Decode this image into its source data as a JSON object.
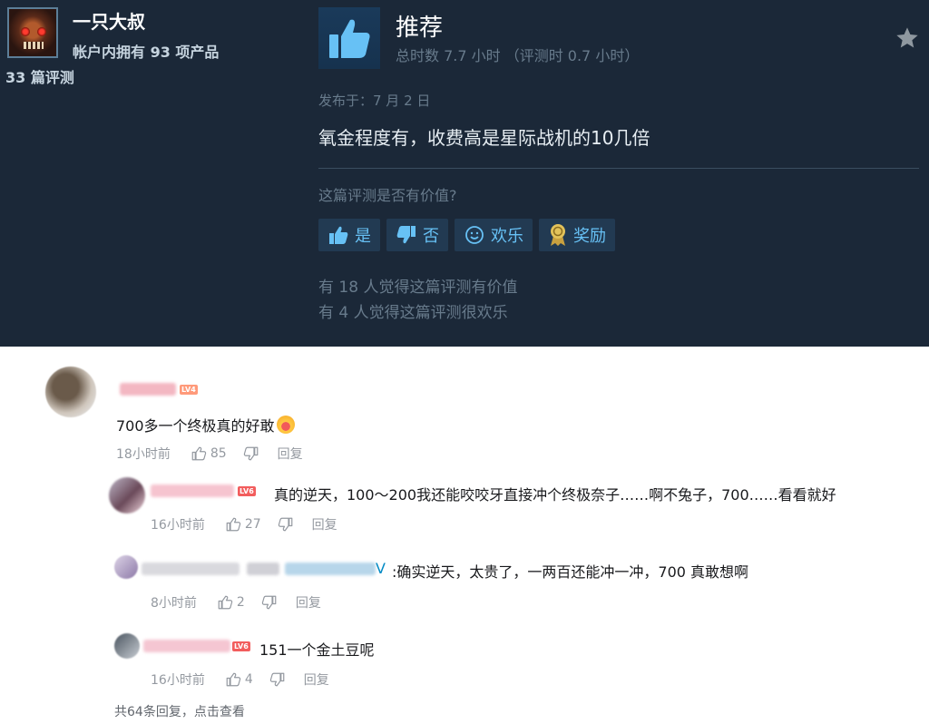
{
  "steam_review": {
    "username": "一只大叔",
    "owned_products": "帐户内拥有 93 项产品",
    "review_count": "33 篇评测",
    "verdict": "推荐",
    "hours": "总时数 7.7 小时 （评测时 0.7 小时）",
    "posted": "发布于：7 月 2 日",
    "body": "氧金程度有，收费高是星际战机的10几倍",
    "helpful_question": "这篇评测是否有价值?",
    "buttons": {
      "yes": "是",
      "no": "否",
      "funny": "欢乐",
      "award": "奖励"
    },
    "stat_helpful": "有 18 人觉得这篇评测有价值",
    "stat_funny": "有 4 人觉得这篇评测很欢乐"
  },
  "comments": {
    "main": {
      "level": "LV4",
      "text": "700多一个终极真的好敢",
      "time": "18小时前",
      "likes": "85",
      "reply": "回复"
    },
    "replies": [
      {
        "level": "LV6",
        "text": "真的逆天，100～200我还能咬咬牙直接冲个终极奈子……啊不兔子，700……看看就好",
        "time": "16小时前",
        "likes": "27",
        "reply": "回复"
      },
      {
        "mention_suffix": "V",
        "text": ":确实逆天，太贵了，一两百还能冲一冲，700 真敢想啊",
        "time": "8小时前",
        "likes": "2",
        "reply": "回复"
      },
      {
        "level": "LV6",
        "text": "151一个金土豆呢",
        "time": "16小时前",
        "likes": "4",
        "reply": "回复"
      }
    ],
    "view_more": "共64条回复，点击查看"
  },
  "colors": {
    "steam_bg": "#1b2838",
    "steam_accent": "#67c1f5",
    "level_red": "#fb7299",
    "muted": "#9499a0"
  }
}
